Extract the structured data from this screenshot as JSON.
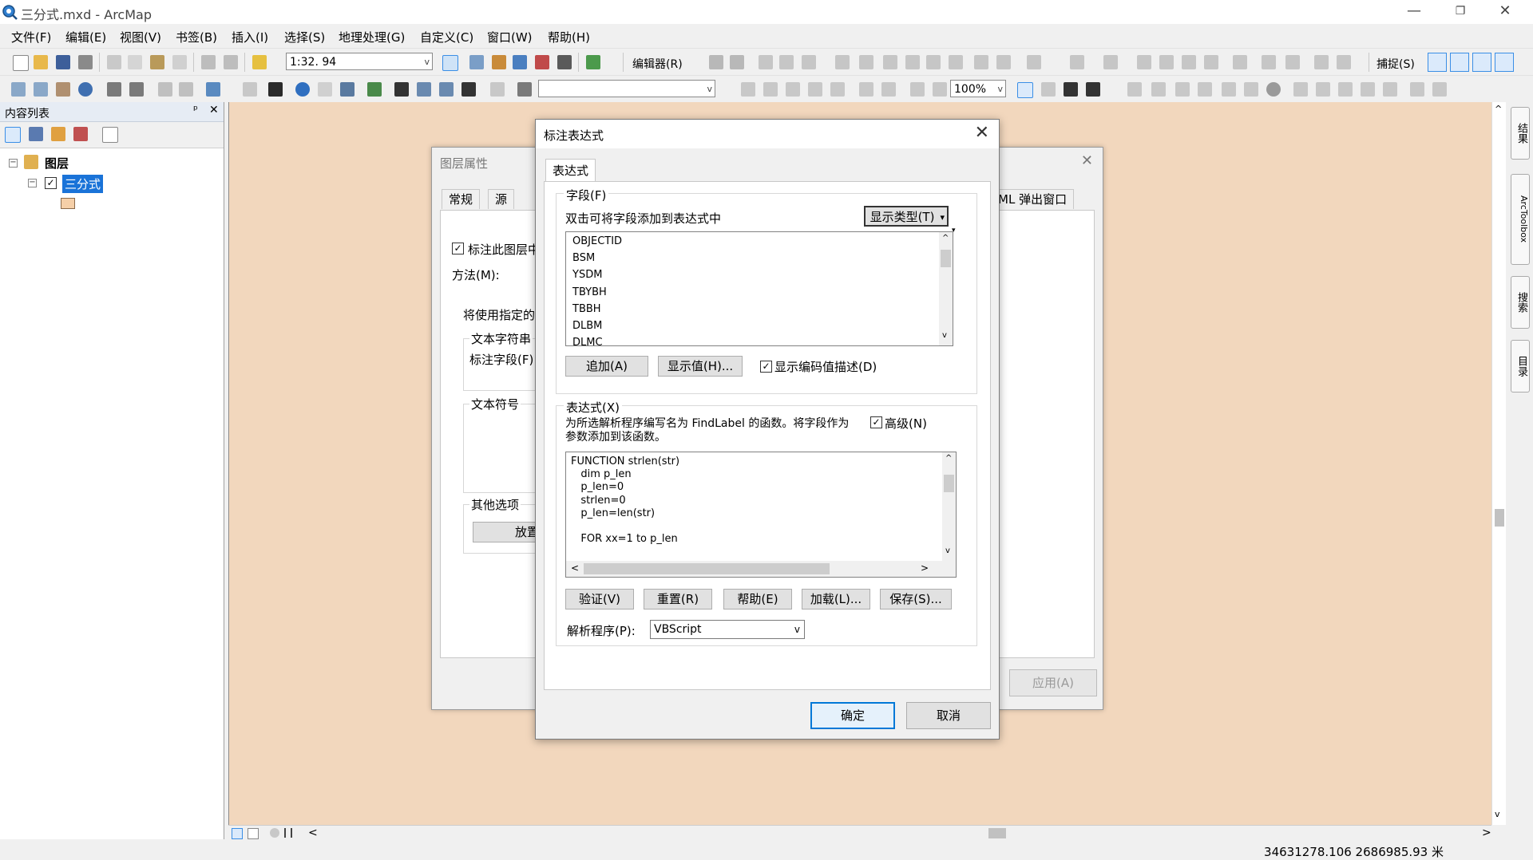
{
  "window": {
    "title": "三分式.mxd - ArcMap",
    "minimize": "—",
    "restore": "❐",
    "close": "✕"
  },
  "menu": [
    "文件(F)",
    "编辑(E)",
    "视图(V)",
    "书签(B)",
    "插入(I)",
    "选择(S)",
    "地理处理(G)",
    "自定义(C)",
    "窗口(W)",
    "帮助(H)"
  ],
  "toolbar": {
    "scale": "1:32. 94",
    "editor_label": "编辑器(R)",
    "snap_label": "捕捉(S)",
    "zoom": "100%"
  },
  "toc": {
    "title": "内容列表",
    "pin": "ᵖ",
    "close": "✕",
    "root_label": "图层",
    "layer_label": "三分式",
    "expander": "−",
    "check": "✓"
  },
  "right_dock": {
    "tabs": [
      "结果",
      "ArcToolbox",
      "搜索",
      "目录"
    ]
  },
  "status": {
    "coords": "34631278.106  2686985.93 米"
  },
  "layer_properties": {
    "title": "图层属性",
    "close": "✕",
    "tabs": [
      "常规",
      "源"
    ],
    "tab_right": "ML 弹出窗口",
    "label_checkbox": "标注此图层中",
    "method_label": "方法(M):",
    "info_text": "将使用指定的",
    "text_string_group": "文本字符串",
    "label_field": "标注字段(F):",
    "text_symbol_group": "文本符号",
    "other_options_group": "其他选项",
    "placement_btn": "放置",
    "apply": "应用(A)"
  },
  "label_expression": {
    "title": "标注表达式",
    "close": "✕",
    "tab": "表达式",
    "fields_group": "字段(F)",
    "fields_hint": "双击可将字段添加到表达式中",
    "show_type_btn": "显示类型(T)",
    "fields": [
      "OBJECTID",
      "BSM",
      "YSDM",
      "TBYBH",
      "TBBH",
      "DLBM",
      "DLMC"
    ],
    "add_btn": "追加(A)",
    "show_values_btn": "显示值(H)...",
    "show_coded_desc": "显示编码值描述(D)",
    "expression_group": "表达式(X)",
    "expression_hint_1": "为所选解析程序编写名为 FindLabel 的函数。将字段作为",
    "expression_hint_2": "参数添加到该函数。",
    "advanced": "高级(N)",
    "code_lines": [
      "FUNCTION strlen(str)",
      "   dim p_len",
      "   p_len=0",
      "   strlen=0",
      "   p_len=len(str)",
      "",
      "   FOR xx=1 to p_len"
    ],
    "verify_btn": "验证(V)",
    "reset_btn": "重置(R)",
    "help_btn": "帮助(E)",
    "load_btn": "加载(L)...",
    "save_btn": "保存(S)...",
    "parser_label": "解析程序(P):",
    "parser_value": "VBScript",
    "ok_btn": "确定",
    "cancel_btn": "取消"
  },
  "icons": {
    "arrow_up": "▲",
    "arrow_down": "▼",
    "arrow_left": "◀",
    "arrow_right": "▶",
    "chev_up": "^",
    "chev_down": "v",
    "chev_left": "<",
    "chev_right": ">",
    "dropdown": "▾",
    "small_dropdown": "▾"
  }
}
